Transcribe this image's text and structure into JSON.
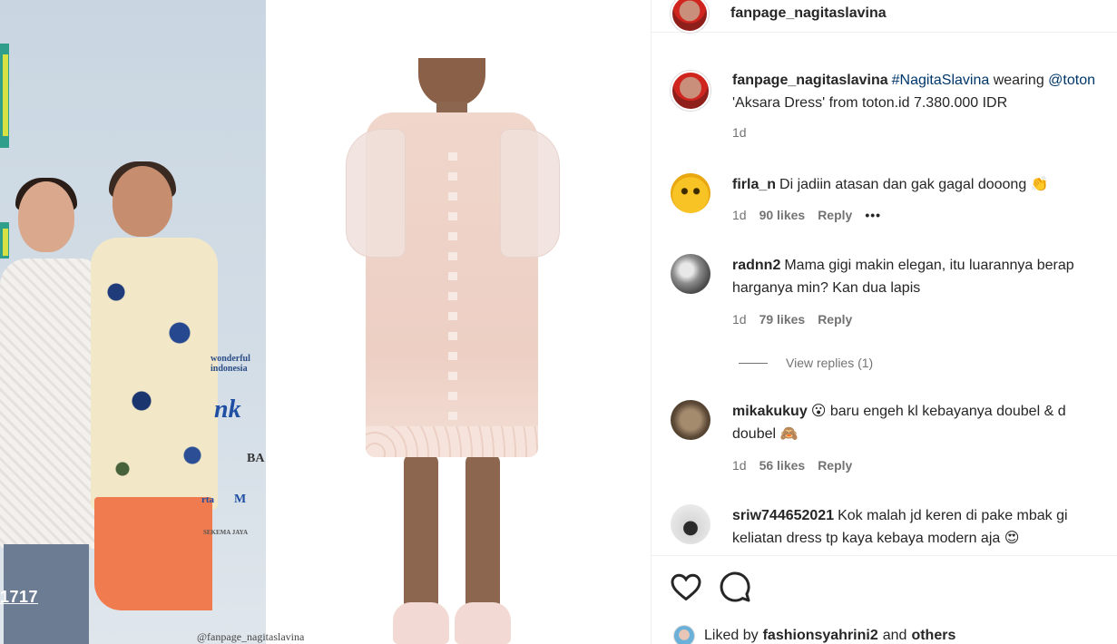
{
  "media": {
    "watermark": "@fanpage_nagitaslavina",
    "left_tag": "1717",
    "backdrop_texts": [
      "wonderful indonesia",
      "nk",
      "BA",
      "rta",
      "M",
      "SEKEMA JAYA"
    ]
  },
  "post": {
    "username": "fanpage_nagitaslavina",
    "caption": {
      "username": "fanpage_nagitaslavina",
      "hashtag": "#NagitaSlavina",
      "word": " wearing ",
      "mention": "@toton",
      "line2": "'Aksara Dress' from toton.id 7.380.000 IDR",
      "time": "1d"
    },
    "comments": [
      {
        "username": "firla_n",
        "text": "Di jadiin atasan dan gak gagal dooong 👏",
        "line2": "",
        "time": "1d",
        "likes": "90 likes",
        "reply": "Reply",
        "more": "•••"
      },
      {
        "username": "radnn2",
        "text": "Mama gigi makin elegan, itu luarannya berap",
        "line2": "harganya min? Kan dua lapis",
        "time": "1d",
        "likes": "79 likes",
        "reply": "Reply"
      },
      {
        "username": "mikakukuy",
        "text": "😮  baru engeh kl kebayanya doubel & d",
        "line2": "doubel 🙈",
        "time": "1d",
        "likes": "56 likes",
        "reply": "Reply"
      },
      {
        "username": "sriw744652021",
        "text": "Kok malah jd keren di pake mbak gi",
        "line2": "keliatan dress tp kaya kebaya modern aja 😍",
        "time": "",
        "likes": "",
        "reply": ""
      }
    ],
    "view_replies": "View replies (1)",
    "liked_by": {
      "prefix": "Liked by",
      "user": "fashionsyahrini2",
      "middle": "and",
      "others": "others"
    }
  },
  "icons": [
    "heart-icon",
    "comment-icon"
  ]
}
